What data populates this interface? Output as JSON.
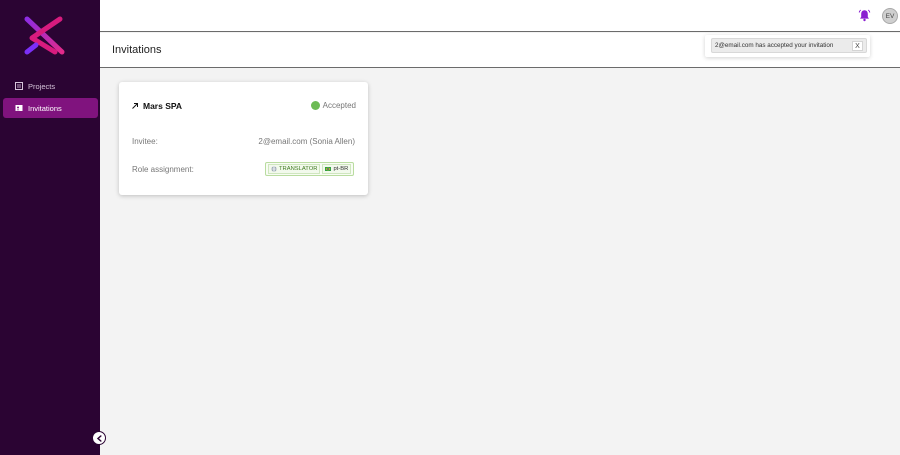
{
  "sidebar": {
    "items": [
      {
        "label": "Projects",
        "icon": "projects-icon"
      },
      {
        "label": "Invitations",
        "icon": "invitations-icon"
      }
    ],
    "active_index": 1
  },
  "topbar": {
    "bell_icon": "bell-icon",
    "avatar_initials": "EV"
  },
  "page": {
    "title": "Invitations"
  },
  "toast": {
    "message": "2@email.com has accepted your invitation",
    "close_label": "X"
  },
  "card": {
    "project_name": "Mars SPA",
    "status": "Accepted",
    "invitee_label": "Invitee:",
    "invitee_value": "2@email.com (Sonia Allen)",
    "role_label": "Role assignment:",
    "role_chips": [
      "TRANSLATOR",
      "pt-BR"
    ]
  },
  "colors": {
    "sidebar_bg": "#2b0433",
    "active_item": "#80137e",
    "accent": "#8a1fd0",
    "status_green": "#6dbb55"
  }
}
